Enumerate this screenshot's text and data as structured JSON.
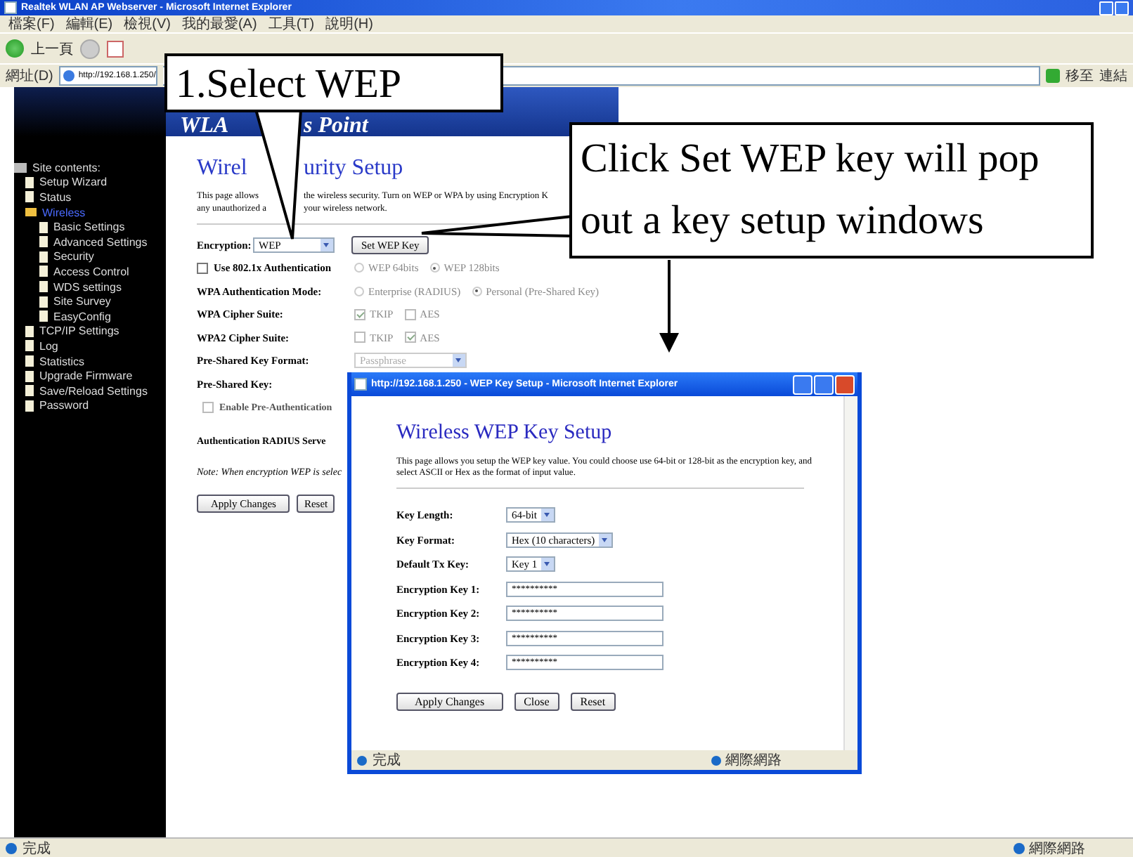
{
  "browser": {
    "title": "Realtek WLAN AP Webserver - Microsoft Internet Explorer",
    "menu": [
      "檔案(F)",
      "編輯(E)",
      "檢視(V)",
      "我的最愛(A)",
      "工具(T)",
      "說明(H)"
    ],
    "back_label": "上一頁",
    "address_label": "網址(D)",
    "address": "http://192.168.1.250/",
    "go_label": "移至",
    "links_label": "連結",
    "status": "完成",
    "zone": "網際網路"
  },
  "header": {
    "title": [
      "WLA",
      "s Point"
    ]
  },
  "sidebar": {
    "title": "Site contents:",
    "items": [
      {
        "label": "Setup Wizard",
        "selected": false
      },
      {
        "label": "Status",
        "selected": false
      },
      {
        "label": "Wireless",
        "selected": true,
        "expanded": true,
        "children": [
          {
            "label": "Basic Settings",
            "selected": false
          },
          {
            "label": "Advanced Settings",
            "selected": false
          },
          {
            "label": "Security",
            "selected": false
          },
          {
            "label": "Access Control",
            "selected": false
          },
          {
            "label": "WDS settings",
            "selected": false
          },
          {
            "label": "Site Survey",
            "selected": false
          },
          {
            "label": "EasyConfig",
            "selected": false
          }
        ]
      },
      {
        "label": "TCP/IP Settings",
        "selected": false
      },
      {
        "label": "Log",
        "selected": false
      },
      {
        "label": "Statistics",
        "selected": false
      },
      {
        "label": "Upgrade Firmware",
        "selected": false
      },
      {
        "label": "Save/Reload Settings",
        "selected": false
      },
      {
        "label": "Password",
        "selected": false
      }
    ]
  },
  "security": {
    "title": [
      "Wirel",
      "urity Setup"
    ],
    "description": [
      [
        "This page allows",
        "the wireless security. Turn on WEP or WPA by using Encryption K"
      ],
      [
        "any unauthorized a",
        "your wireless network."
      ]
    ],
    "encryption": {
      "label": "Encryption:",
      "value": "WEP",
      "button": "Set WEP Key"
    },
    "rows": [
      {
        "kind": "check-radio",
        "label": "Use 802.1x Authentication",
        "checked": false,
        "disabled": true,
        "options": [
          {
            "label": "WEP 64bits",
            "selected": false
          },
          {
            "label": "WEP 128bits",
            "selected": true
          }
        ]
      },
      {
        "kind": "radio",
        "label": "WPA Authentication Mode:",
        "disabled": true,
        "options": [
          {
            "label": "Enterprise (RADIUS)",
            "selected": false
          },
          {
            "label": "Personal (Pre-Shared Key)",
            "selected": true
          }
        ]
      },
      {
        "kind": "checks",
        "label": "WPA Cipher Suite:",
        "disabled": true,
        "options": [
          {
            "label": "TKIP",
            "checked": true
          },
          {
            "label": "AES",
            "checked": false
          }
        ]
      },
      {
        "kind": "checks",
        "label": "WPA2 Cipher Suite:",
        "disabled": true,
        "options": [
          {
            "label": "TKIP",
            "checked": false
          },
          {
            "label": "AES",
            "checked": true
          }
        ]
      },
      {
        "kind": "select",
        "label": "Pre-Shared Key Format:",
        "disabled": true,
        "value": "Passphrase"
      },
      {
        "kind": "text",
        "label": "Pre-Shared Key:"
      },
      {
        "kind": "check",
        "label": "Enable Pre-Authentication",
        "checked": false,
        "disabled": true
      }
    ],
    "radius_label": "Authentication RADIUS Serve",
    "note": "Note: When encryption WEP is selec",
    "buttons": [
      "Apply Changes",
      "Reset"
    ]
  },
  "popup": {
    "title": "http://192.168.1.250 - WEP Key Setup - Microsoft Internet Explorer",
    "heading": "Wireless WEP Key Setup",
    "description": "This page allows you setup the WEP key value. You could choose use 64-bit or 128-bit as the encryption key, and select ASCII or Hex as the format of input value.",
    "fields": [
      {
        "kind": "select",
        "label": "Key Length:",
        "value": "64-bit"
      },
      {
        "kind": "select",
        "label": "Key Format:",
        "value": "Hex (10 characters)"
      },
      {
        "kind": "select",
        "label": "Default Tx Key:",
        "value": "Key 1"
      },
      {
        "kind": "password",
        "label": "Encryption Key 1:",
        "value": "**********"
      },
      {
        "kind": "password",
        "label": "Encryption Key 2:",
        "value": "**********"
      },
      {
        "kind": "password",
        "label": "Encryption Key 3:",
        "value": "**********"
      },
      {
        "kind": "password",
        "label": "Encryption Key 4:",
        "value": "**********"
      }
    ],
    "buttons": [
      "Apply Changes",
      "Close",
      "Reset"
    ],
    "status": "完成",
    "zone": "網際網路"
  },
  "callouts": [
    {
      "text": "1.Select WEP"
    },
    {
      "text": "Click Set WEP key will pop out a key setup windows"
    }
  ]
}
